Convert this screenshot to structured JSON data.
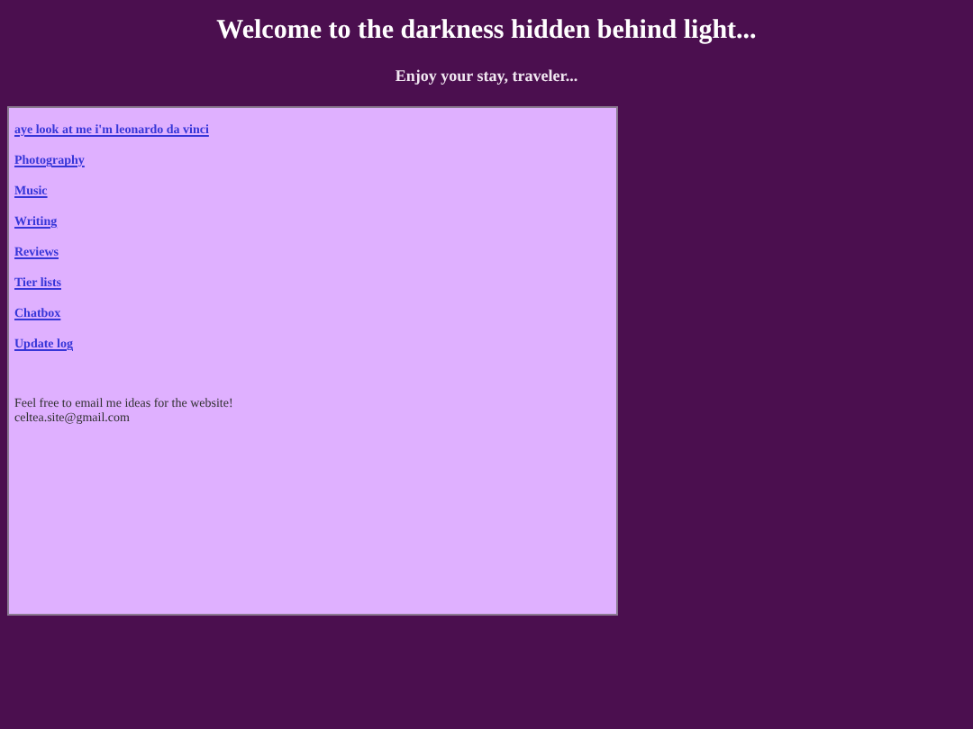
{
  "header": {
    "title": "Welcome to the darkness hidden behind light...",
    "subtitle": "Enjoy your stay, traveler..."
  },
  "nav": {
    "links": [
      "aye look at me i'm leonardo da vinci",
      "Photography",
      "Music",
      "Writing",
      "Reviews",
      "Tier lists",
      "Chatbox",
      "Update log"
    ]
  },
  "note": {
    "lines": [
      "Feel free to email me ideas for the website!",
      "celtea.site@gmail.com"
    ]
  }
}
